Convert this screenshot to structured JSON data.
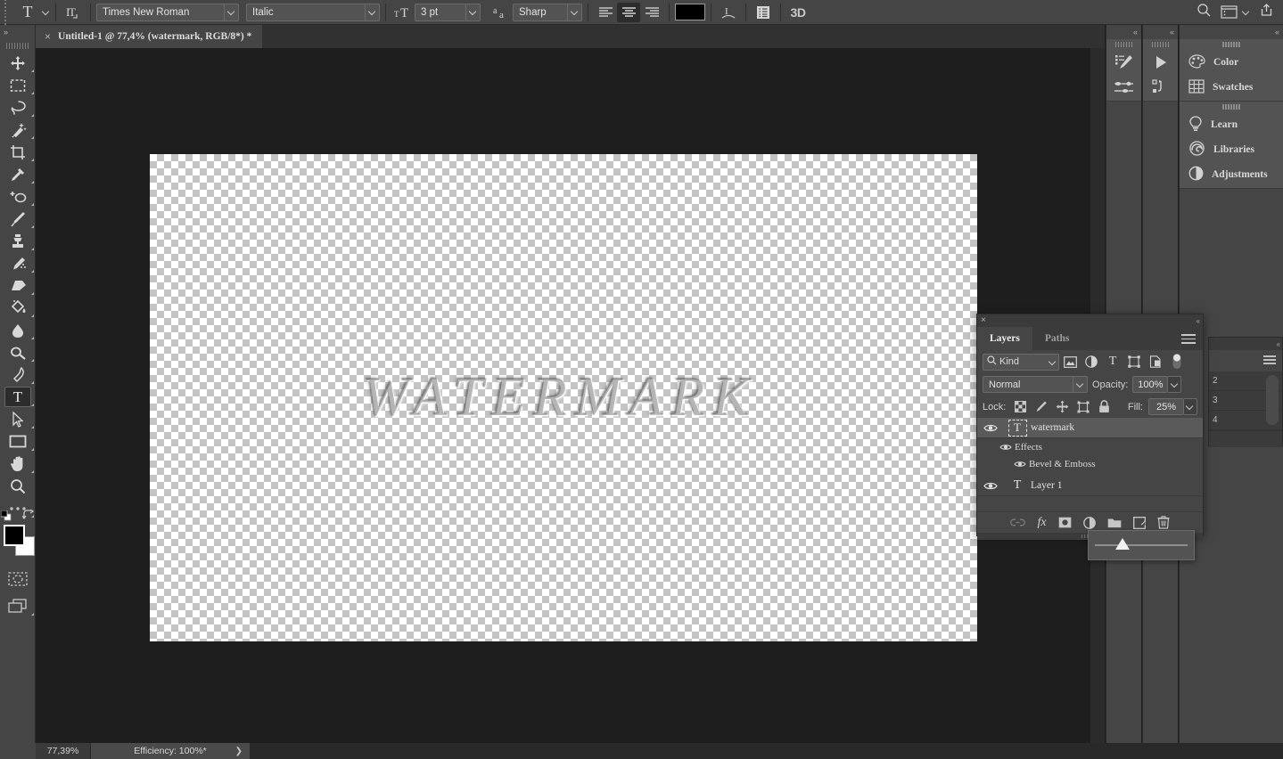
{
  "options_bar": {
    "tool_icon": "text-tool-icon",
    "orientation_icon": "text-orientation-icon",
    "font_family": "Times New Roman",
    "font_style": "Italic",
    "font_size": "3 pt",
    "anti_alias_icon": "anti-alias-icon",
    "anti_alias": "Sharp",
    "align_left": "align-left-icon",
    "align_center": "align-center-icon",
    "align_right": "align-right-icon",
    "text_color": "#000000",
    "warp_icon": "warp-text-icon",
    "panels_icon": "character-panel-icon",
    "three_d_label": "3D",
    "search_icon": "search-icon",
    "workspace_icon": "workspace-icon",
    "share_icon": "share-icon"
  },
  "toolbar": {
    "collapse_label": "»",
    "tools": [
      {
        "name": "move-tool",
        "icon": "move-icon"
      },
      {
        "name": "marquee-tool",
        "icon": "rectangular-marquee-icon"
      },
      {
        "name": "lasso-tool",
        "icon": "lasso-icon"
      },
      {
        "name": "magic-wand-tool",
        "icon": "quick-selection-icon"
      },
      {
        "name": "crop-tool",
        "icon": "crop-icon"
      },
      {
        "name": "eyedropper-tool",
        "icon": "eyedropper-icon"
      },
      {
        "name": "spot-healing-tool",
        "icon": "spot-healing-brush-icon"
      },
      {
        "name": "brush-tool",
        "icon": "brush-icon"
      },
      {
        "name": "clone-stamp-tool",
        "icon": "clone-stamp-icon"
      },
      {
        "name": "history-brush-tool",
        "icon": "history-brush-icon"
      },
      {
        "name": "eraser-tool",
        "icon": "eraser-icon"
      },
      {
        "name": "gradient-tool",
        "icon": "paint-bucket-icon"
      },
      {
        "name": "blur-tool",
        "icon": "blur-icon"
      },
      {
        "name": "dodge-tool",
        "icon": "dodge-icon"
      },
      {
        "name": "pen-tool",
        "icon": "pen-icon"
      },
      {
        "name": "type-tool",
        "icon": "type-icon",
        "selected": true,
        "glyph": "T"
      },
      {
        "name": "path-selection-tool",
        "icon": "path-selection-icon"
      },
      {
        "name": "rectangle-tool",
        "icon": "rectangle-icon"
      },
      {
        "name": "hand-tool",
        "icon": "hand-icon"
      },
      {
        "name": "zoom-tool",
        "icon": "zoom-icon"
      },
      {
        "name": "edit-toolbar",
        "icon": "more-tools-icon"
      }
    ],
    "quick_mask": "quick-mask-icon",
    "screen_mode": "screen-mode-icon",
    "foreground_color": "#000000",
    "background_color": "#ffffff"
  },
  "document_tab": {
    "close_label": "×",
    "title": "Untitled-1 @ 77,4% (watermark, RGB/8*) *"
  },
  "canvas": {
    "watermark_text": "WATERMARK"
  },
  "status_bar": {
    "zoom": "77,39%",
    "info": "Efficiency: 100%*",
    "expand_arrow": "❯"
  },
  "right_docks": {
    "dock_a": {
      "collapse_label": "«",
      "items": [
        {
          "name": "brush-settings-panel-icon",
          "label": ""
        },
        {
          "name": "brush-presets-panel-icon",
          "label": ""
        }
      ]
    },
    "dock_b": {
      "collapse_label": "«",
      "items": [
        {
          "name": "actions-panel-icon",
          "label": ""
        },
        {
          "name": "history-panel-icon",
          "label": ""
        }
      ]
    },
    "dock_c": {
      "collapse_label": "«",
      "group1": [
        {
          "name": "color-panel",
          "icon": "color-palette-icon",
          "label": "Color"
        },
        {
          "name": "swatches-panel",
          "icon": "swatches-grid-icon",
          "label": "Swatches"
        }
      ],
      "group2": [
        {
          "name": "learn-panel",
          "icon": "lightbulb-icon",
          "label": "Learn"
        },
        {
          "name": "libraries-panel",
          "icon": "creative-cloud-icon",
          "label": "Libraries"
        },
        {
          "name": "adjustments-panel",
          "icon": "adjustments-circle-icon",
          "label": "Adjustments"
        }
      ]
    }
  },
  "behind_panel": {
    "collapse_label": "«",
    "rows": [
      "2",
      "3",
      "4"
    ]
  },
  "layers_panel": {
    "close_label": "×",
    "collapse_label": "«",
    "tabs": [
      {
        "label": "Layers",
        "active": true
      },
      {
        "label": "Paths",
        "active": false
      }
    ],
    "menu_icon": "panel-menu-icon",
    "filter": {
      "kind_label": "Kind",
      "search_icon": "search-icon",
      "icons": [
        "filter-pixel-icon",
        "filter-adjustment-icon",
        "filter-type-icon",
        "filter-shape-icon",
        "filter-smart-object-icon",
        "filter-toggle-switch"
      ]
    },
    "blend_mode": "Normal",
    "opacity_label": "Opacity:",
    "opacity_value": "100%",
    "lock_label": "Lock:",
    "lock_icons": [
      "lock-transparent-pixels-icon",
      "lock-image-pixels-icon",
      "lock-position-icon",
      "lock-artboard-nesting-icon",
      "lock-all-icon"
    ],
    "fill_label": "Fill:",
    "fill_value": "25%",
    "slider_percent": 25,
    "layers": [
      {
        "name": "watermark",
        "visible": true,
        "selected": true,
        "thumb_glyph": "T",
        "effects": {
          "label": "Effects",
          "visible": true,
          "items": [
            {
              "label": "Bevel & Emboss",
              "visible": true
            }
          ]
        }
      },
      {
        "name": "Layer 1",
        "visible": true,
        "selected": false,
        "thumb_glyph": "T"
      }
    ],
    "footer_icons": [
      "link-layers-icon",
      "layer-style-fx-icon",
      "add-layer-mask-icon",
      "new-adjustment-layer-icon",
      "new-group-icon",
      "new-layer-icon",
      "delete-layer-icon"
    ]
  }
}
